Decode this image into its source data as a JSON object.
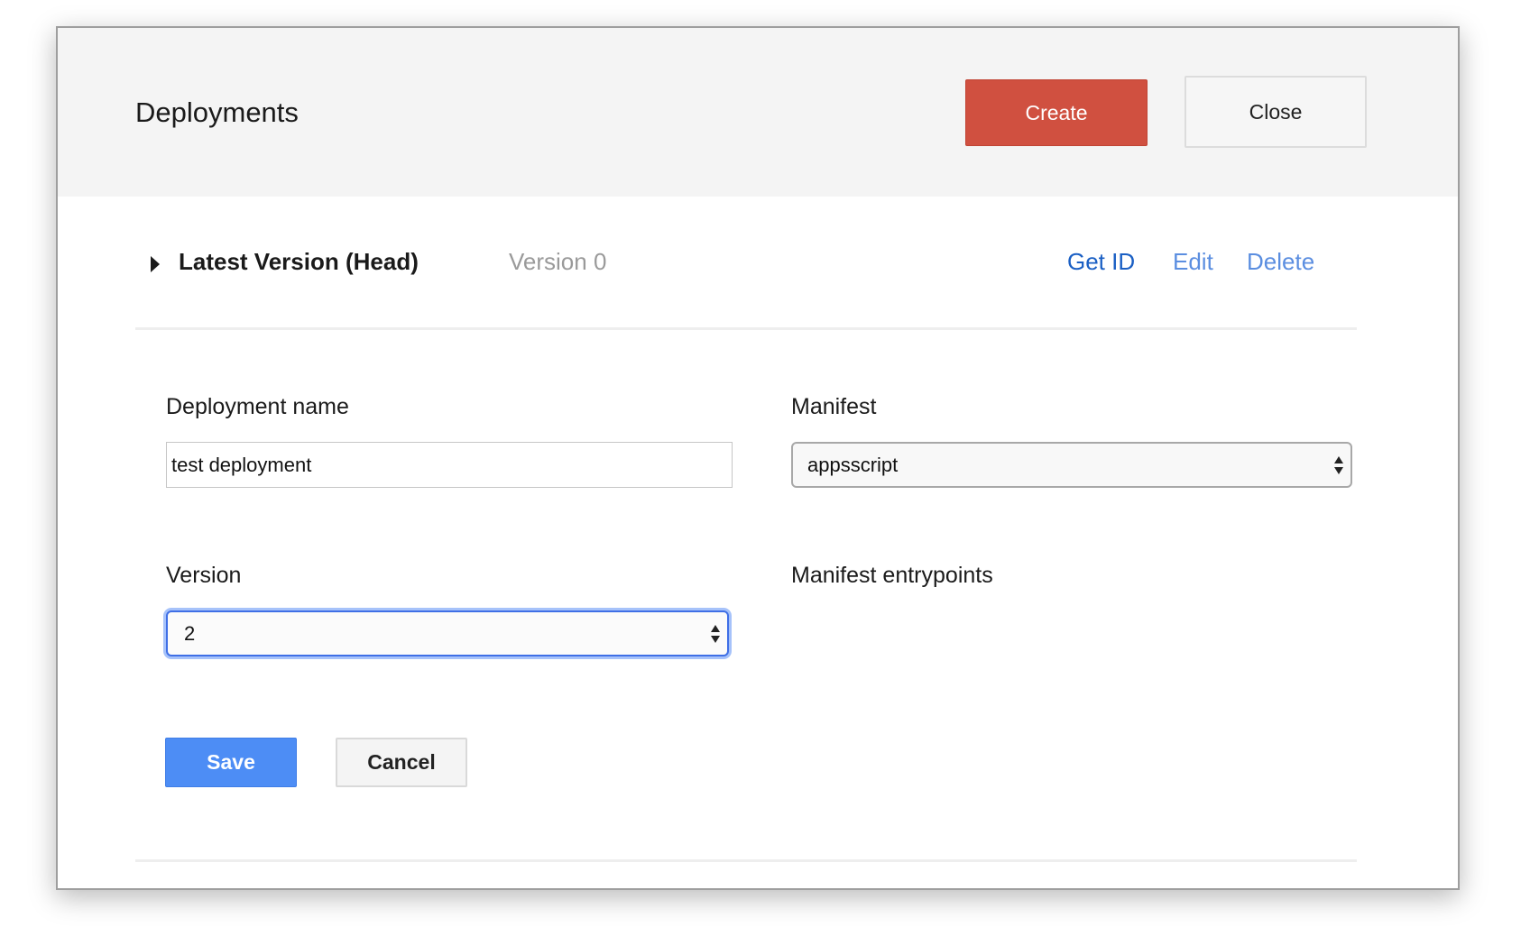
{
  "dialog": {
    "title": "Deployments",
    "create_label": "Create",
    "close_label": "Close",
    "colors": {
      "create": "#d05040",
      "save": "#4d8df5",
      "link": "#1a5fc4",
      "focus": "#3f6fe6"
    }
  },
  "deployment": {
    "name": "Latest Version (Head)",
    "version": "Version 0",
    "actions": {
      "get_id": "Get ID",
      "edit": "Edit",
      "delete": "Delete"
    }
  },
  "form": {
    "deployment_name": {
      "label": "Deployment name",
      "value": "test deployment"
    },
    "manifest": {
      "label": "Manifest",
      "value": "appsscript"
    },
    "version": {
      "label": "Version",
      "value": "2"
    },
    "manifest_entrypoints": {
      "label": "Manifest entrypoints"
    },
    "save_label": "Save",
    "cancel_label": "Cancel"
  },
  "icons": {
    "expand": "caret-right-icon",
    "select": "select-arrows-icon"
  }
}
